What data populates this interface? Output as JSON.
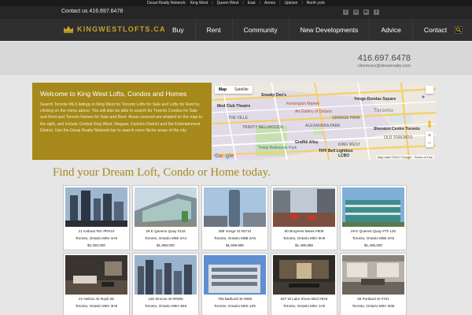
{
  "network_bar": {
    "label": "Desai Realty Network:",
    "links": [
      "King West",
      "Queen West",
      "East",
      "Annex",
      "Uptown",
      "North york"
    ]
  },
  "topbar": {
    "contact": "Contact us 416.697.6478",
    "social_icons": [
      "facebook-icon",
      "linkedin-icon",
      "youtube-icon",
      "twitter-icon"
    ]
  },
  "header": {
    "logo_text": "KINGWESTLOFTS.CA",
    "nav": [
      "Buy",
      "Rent",
      "Community",
      "New Developments",
      "Advice",
      "Contact"
    ]
  },
  "band": {
    "phone": "416.697.6478",
    "email": "clientcare@desairealty.com"
  },
  "welcome": {
    "title": "Welcome to King West Lofts, Condos and Homes",
    "text": "Search Toronto MLS listings in King West for Toronto Lofts for Sale and Lofts for Rent by clicking on the menu above. You will also be able to search for Toronto Condos for Sale and Rent and Toronto Homes for Sale and Rent. Areas covered are shaded on the map to the right, and include Central King West, Niagara, Fashion District and the Entertainment District. Use the Desai Realty Network bar to search more Niche areas of the city."
  },
  "map": {
    "toggle": [
      "Map",
      "Satellite"
    ],
    "labels": {
      "sneaky_dees": "Sneaky Dee's",
      "mod_club": "Mod Club Theatre",
      "kensington": "Kensington Market",
      "ago": "Art Gallery of Ontario",
      "yonge_dundas": "Yonge-Dundas Square",
      "the_ville": "THE VILLE",
      "trinity_bellwoods": "TRINITY BELLWOODS",
      "alexandra_park": "ALEXANDRA PARK",
      "toronto": "Toronto",
      "grange_park": "GRANGE PARK",
      "trinity_bellwoods_park": "Trinity Bellwoods Park",
      "graffiti_alley": "Graffiti Alley",
      "sheraton": "Sheraton Centre Toronto",
      "old_toronto": "OLD TORONTO",
      "king_west": "KING WEST",
      "tiff": "TIFF Bell Lightbox",
      "lcbo": "LCBO"
    },
    "google": "Google",
    "footer": [
      "Map data ©2017 Google",
      "Terms of Use"
    ],
    "zoom": [
      "+",
      "−"
    ]
  },
  "headline": "Find your Dream Loft, Condo or Home today.",
  "listings": [
    {
      "address": "21 Iceboat Terr #PH10",
      "city": "Toronto, Ontario M5V 4A9",
      "price": "$2,350,000",
      "scene": "towers"
    },
    {
      "address": "29 E Queens Quay #118",
      "city": "Toronto, Ontario M5E 0A4",
      "price": "$1,988,000",
      "scene": "glass"
    },
    {
      "address": "386 Yonge St #5710",
      "city": "Toronto, Ontario M5B 0A5",
      "price": "$1,599,990",
      "scene": "tower"
    },
    {
      "address": "50 Bruyeres Mews #909",
      "city": "Toronto, Ontario M5V 0H8",
      "price": "$1,488,888",
      "scene": "terrace"
    },
    {
      "address": "29 E Queens Quay #Th 120",
      "city": "Toronto, Ontario M5E 0A5",
      "price": "$1,488,000",
      "scene": "teal"
    },
    {
      "address": "21 Nelson St #Uph 06",
      "city": "Toronto, Ontario M5V 3H9",
      "price": "",
      "scene": "interior"
    },
    {
      "address": "126 Simcoe St #P605",
      "city": "Toronto, Ontario M5H 4E6",
      "price": "",
      "scene": "city"
    },
    {
      "address": "783 Bathurst St #805",
      "city": "Toronto, Ontario M5S 1Z5",
      "price": "",
      "scene": "blue"
    },
    {
      "address": "637 W Lake Shore Blvd #833",
      "city": "Toronto, Ontario M5V 1A8",
      "price": "",
      "scene": "lobby"
    },
    {
      "address": "66 Portland St #701",
      "city": "Toronto, Ontario M5V 2M6",
      "price": "",
      "scene": "loft"
    }
  ]
}
